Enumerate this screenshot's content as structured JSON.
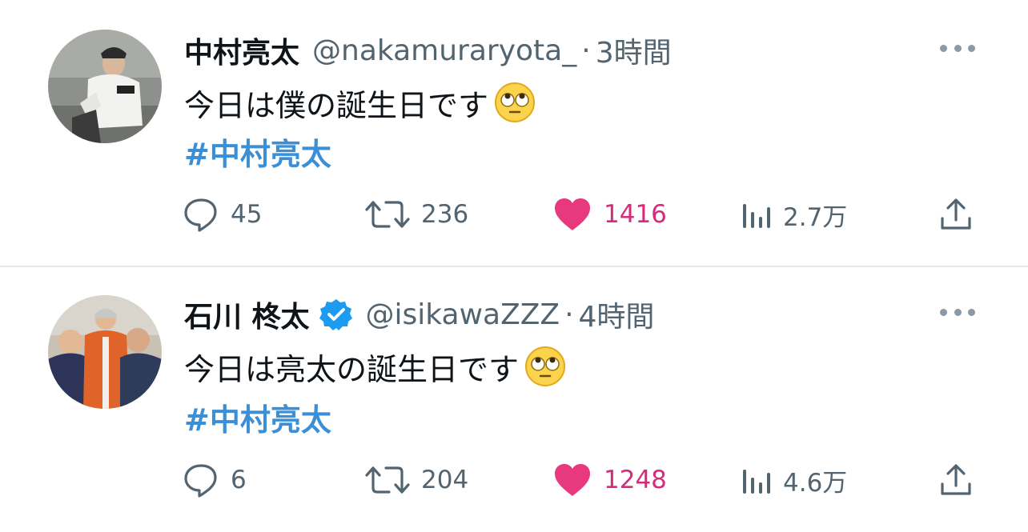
{
  "tweets": [
    {
      "name": "中村亮太",
      "verified": false,
      "handle": "@nakamuraryota_",
      "dot": "·",
      "time": "3時間",
      "text": "今日は僕の誕生日です",
      "hashtag": "#中村亮太",
      "replies": "45",
      "retweets": "236",
      "likes": "1416",
      "views": "2.7万"
    },
    {
      "name": "石川 柊太",
      "verified": true,
      "handle": "@isikawaZZZ",
      "dot": "·",
      "time": "4時間",
      "text": "今日は亮太の誕生日です",
      "hashtag": "#中村亮太",
      "replies": "6",
      "retweets": "204",
      "likes": "1248",
      "views": "4.6万"
    }
  ],
  "icons": {
    "reply": "speech-bubble-icon",
    "retweet": "retweet-icon",
    "like": "heart-icon",
    "views": "bar-chart-icon",
    "share": "share-upload-icon",
    "more": "more-dots-icon",
    "verified": "verified-badge-icon",
    "emoji": "eye-roll-emoji"
  },
  "colors": {
    "hashtag": "#3a8fd6",
    "like": "#e0245e",
    "muted": "#536471",
    "verified": "#1d9bf0"
  }
}
